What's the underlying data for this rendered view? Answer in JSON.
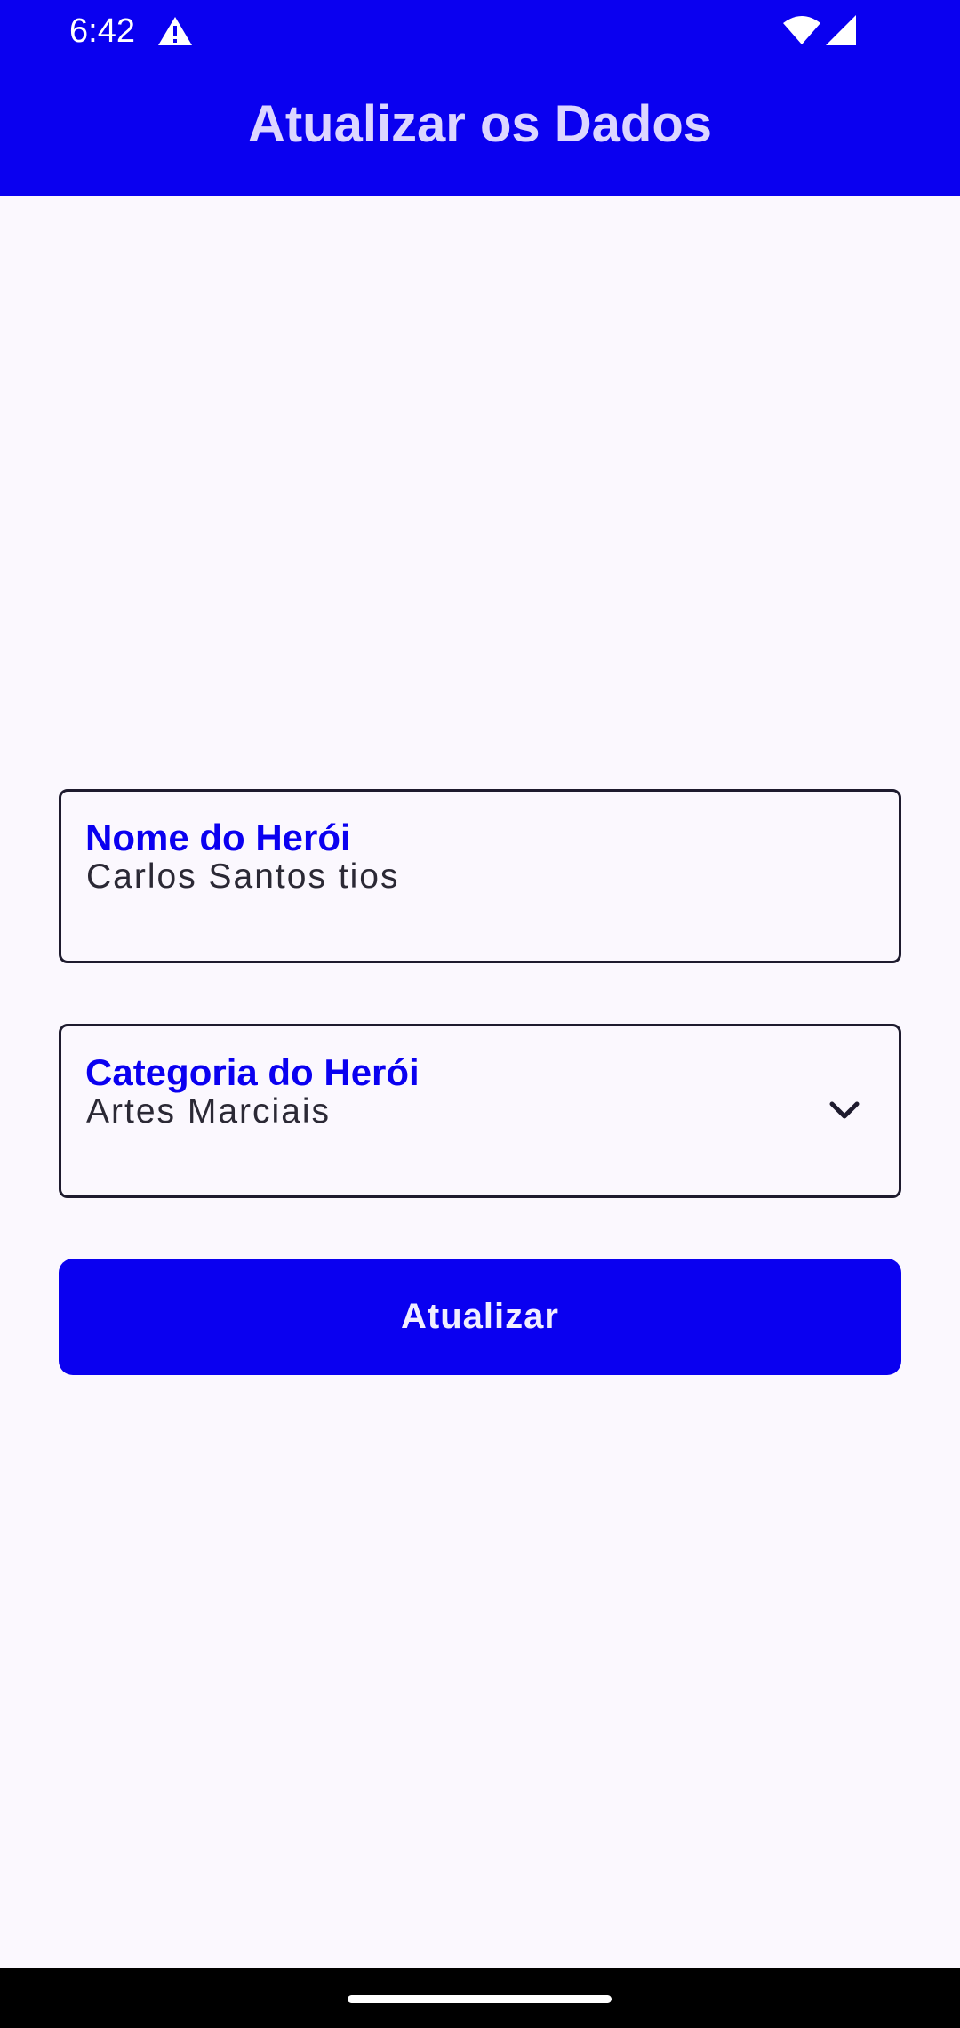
{
  "status_bar": {
    "time": "6:42",
    "icons": [
      "alert-icon",
      "wifi-icon",
      "signal-icon"
    ]
  },
  "app_bar": {
    "title": "Atualizar os Dados",
    "background_color": "#0A00F0"
  },
  "form": {
    "name_field": {
      "label": "Nome do Herói",
      "value": "Carlos Santos tios"
    },
    "category_field": {
      "label": "Categoria do Herói",
      "value": "Artes Marciais",
      "icon": "chevron-down-icon"
    },
    "submit_button": {
      "label": "Atualizar"
    }
  },
  "colors": {
    "accent": "#0A00F0",
    "background": "#FBF8FE",
    "field_border": "#1E1B2E",
    "text": "#2B2935"
  }
}
